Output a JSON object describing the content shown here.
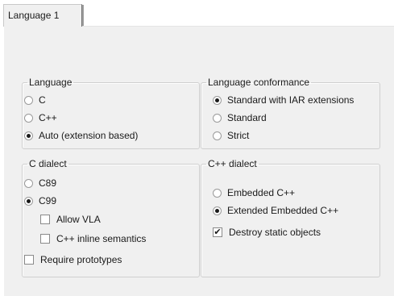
{
  "tab": {
    "label": "Language 1"
  },
  "language": {
    "title": "Language",
    "options": [
      "C",
      "C++",
      "Auto (extension based)"
    ],
    "selected": "Auto (extension based)"
  },
  "conformance": {
    "title": "Language conformance",
    "options": [
      "Standard with IAR extensions",
      "Standard",
      "Strict"
    ],
    "selected": "Standard with IAR extensions"
  },
  "c_dialect": {
    "title": "C dialect",
    "options": [
      "C89",
      "C99"
    ],
    "selected": "C99",
    "allow_vla": {
      "label": "Allow VLA",
      "checked": false
    },
    "cpp_inline": {
      "label": "C++ inline semantics",
      "checked": false
    },
    "require_prototypes": {
      "label": "Require prototypes",
      "checked": false
    }
  },
  "cpp_dialect": {
    "title": "C++ dialect",
    "options": [
      "Embedded C++",
      "Extended Embedded C++"
    ],
    "selected": "Extended Embedded C++",
    "destroy_static": {
      "label": "Destroy static objects",
      "checked": true
    }
  },
  "icons": {
    "checkmark": "✔"
  }
}
